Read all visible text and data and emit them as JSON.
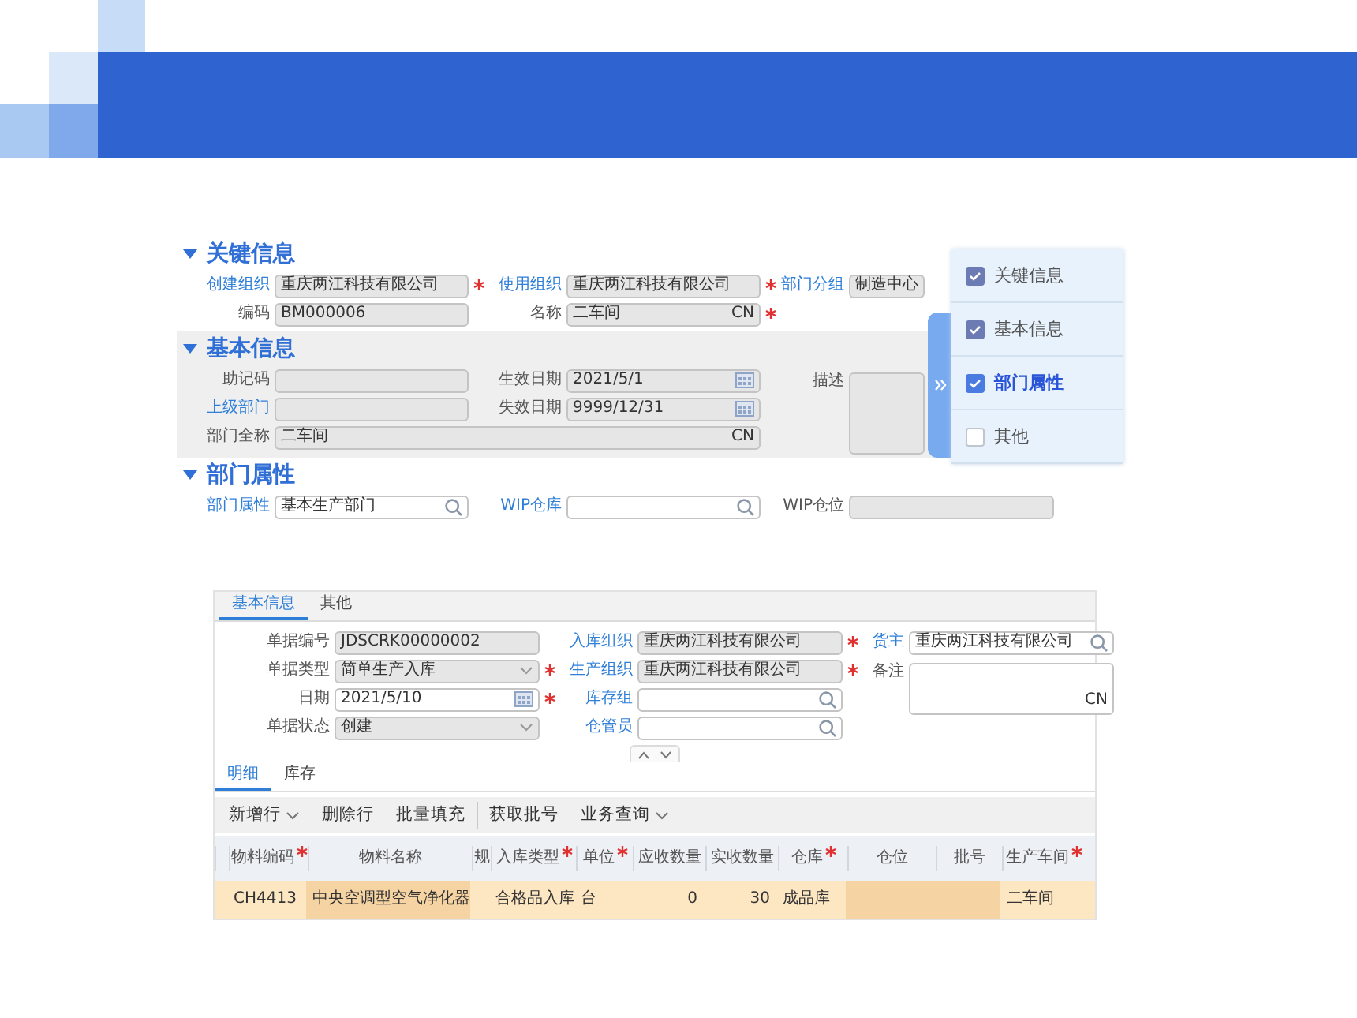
{
  "department_form": {
    "sections": [
      {
        "title": "关键信息",
        "expanded": true,
        "shaded": false,
        "rows": [
          [
            {
              "label": "创建组织",
              "link": true,
              "value": "重庆两江科技有限公司",
              "kind": "text",
              "readonly": true,
              "required": true
            },
            {
              "label": "使用组织",
              "link": true,
              "value": "重庆两江科技有限公司",
              "kind": "text",
              "readonly": true,
              "required": true
            }
          ],
          [
            {
              "label": "编码",
              "link": false,
              "value": "BM000006",
              "kind": "text",
              "readonly": true,
              "required": false
            },
            {
              "label": "名称",
              "link": false,
              "value": "二车间",
              "suffix": "CN",
              "kind": "text",
              "readonly": true,
              "required": true
            }
          ]
        ],
        "side": [
          {
            "label": "部门分组",
            "link": true,
            "value": "制造中心",
            "kind": "text",
            "readonly": true,
            "required": false
          }
        ]
      },
      {
        "title": "基本信息",
        "expanded": true,
        "shaded": true,
        "rows": [
          [
            {
              "label": "助记码",
              "link": false,
              "kind": "text",
              "readonly": true,
              "required": false
            },
            {
              "label": "生效日期",
              "link": false,
              "value": "2021/5/1",
              "kind": "date",
              "readonly": true,
              "required": false
            }
          ],
          [
            {
              "label": "上级部门",
              "link": true,
              "kind": "text",
              "readonly": true,
              "required": false
            },
            {
              "label": "失效日期",
              "link": false,
              "value": "9999/12/31",
              "kind": "date",
              "readonly": true,
              "required": false
            }
          ],
          [
            {
              "label": "部门全称",
              "link": false,
              "value": "二车间",
              "suffix": "CN",
              "kind": "text",
              "readonly": true,
              "required": false
            }
          ]
        ],
        "side": [
          {
            "label": "描述",
            "link": false,
            "kind": "textarea",
            "readonly": true,
            "required": false
          }
        ]
      },
      {
        "title": "部门属性",
        "expanded": true,
        "shaded": false,
        "rows": [
          [
            {
              "label": "部门属性",
              "link": true,
              "value": "基本生产部门",
              "kind": "search",
              "readonly": false,
              "required": false
            },
            {
              "label": "WIP仓库",
              "link": true,
              "kind": "search",
              "readonly": false,
              "required": false
            }
          ]
        ],
        "side": [
          {
            "label": "WIP仓位",
            "link": false,
            "kind": "text",
            "readonly": true,
            "required": false
          }
        ]
      }
    ],
    "section_panel": {
      "items": [
        {
          "label": "关键信息",
          "checked": true,
          "disabled": true,
          "selected": false
        },
        {
          "label": "基本信息",
          "checked": true,
          "disabled": true,
          "selected": false
        },
        {
          "label": "部门属性",
          "checked": true,
          "disabled": false,
          "selected": true
        },
        {
          "label": "其他",
          "checked": false,
          "disabled": false,
          "selected": false
        }
      ]
    }
  },
  "receipt_form": {
    "tabs": [
      {
        "label": "基本信息",
        "selected": true
      },
      {
        "label": "其他",
        "selected": false
      }
    ],
    "rows": [
      [
        {
          "label": "单据编号",
          "link": false,
          "value": "JDSCRK00000002",
          "kind": "text",
          "readonly": true,
          "required": false
        },
        {
          "label": "入库组织",
          "link": true,
          "value": "重庆两江科技有限公司",
          "kind": "text",
          "readonly": true,
          "required": true
        }
      ],
      [
        {
          "label": "单据类型",
          "link": false,
          "value": "简单生产入库",
          "kind": "dropdown",
          "readonly": true,
          "required": true
        },
        {
          "label": "生产组织",
          "link": true,
          "value": "重庆两江科技有限公司",
          "kind": "text",
          "readonly": true,
          "required": true
        }
      ],
      [
        {
          "label": "日期",
          "link": false,
          "value": "2021/5/10",
          "kind": "date",
          "readonly": false,
          "required": true
        },
        {
          "label": "库存组",
          "link": true,
          "kind": "search",
          "readonly": false,
          "required": false
        }
      ],
      [
        {
          "label": "单据状态",
          "link": false,
          "value": "创建",
          "kind": "dropdown",
          "readonly": true,
          "required": false
        },
        {
          "label": "仓管员",
          "link": true,
          "kind": "search",
          "readonly": false,
          "required": false
        }
      ]
    ],
    "side": [
      {
        "label": "货主",
        "link": true,
        "value": "重庆两江科技有限公司",
        "kind": "search",
        "readonly": false,
        "required": false
      },
      {
        "label": "备注",
        "link": false,
        "suffix": "CN",
        "kind": "textarea",
        "readonly": false,
        "required": false
      }
    ],
    "detail_tabs": [
      {
        "label": "明细",
        "selected": true
      },
      {
        "label": "库存",
        "selected": false
      }
    ],
    "toolbar": [
      [
        {
          "label": "新增行",
          "menu": true
        },
        {
          "label": "删除行",
          "menu": false
        },
        {
          "label": "批量填充",
          "menu": false
        }
      ],
      [
        {
          "label": "获取批号",
          "menu": false
        },
        {
          "label": "业务查询",
          "menu": true
        }
      ]
    ],
    "table": {
      "columns": [
        {
          "label": "物料编码",
          "required": true,
          "shaded": false,
          "kind": "text"
        },
        {
          "label": "物料名称",
          "required": false,
          "shaded": true,
          "kind": "text"
        },
        {
          "label": "规",
          "required": false,
          "shaded": false,
          "kind": "text"
        },
        {
          "label": "入库类型",
          "required": true,
          "shaded": false,
          "kind": "text"
        },
        {
          "label": "单位",
          "required": true,
          "shaded": false,
          "kind": "text"
        },
        {
          "label": "应收数量",
          "required": false,
          "shaded": false,
          "kind": "number"
        },
        {
          "label": "实收数量",
          "required": false,
          "shaded": false,
          "kind": "number"
        },
        {
          "label": "仓库",
          "required": true,
          "shaded": false,
          "kind": "text"
        },
        {
          "label": "仓位",
          "required": false,
          "shaded": true,
          "kind": "text"
        },
        {
          "label": "批号",
          "required": false,
          "shaded": true,
          "kind": "text"
        },
        {
          "label": "生产车间",
          "required": true,
          "shaded": false,
          "kind": "text"
        }
      ],
      "rows": [
        [
          "CH4413",
          "中央空调型空气净化器",
          null,
          "合格品入库",
          "台",
          "0",
          "30",
          "成品库",
          null,
          null,
          "二车间"
        ]
      ]
    }
  }
}
